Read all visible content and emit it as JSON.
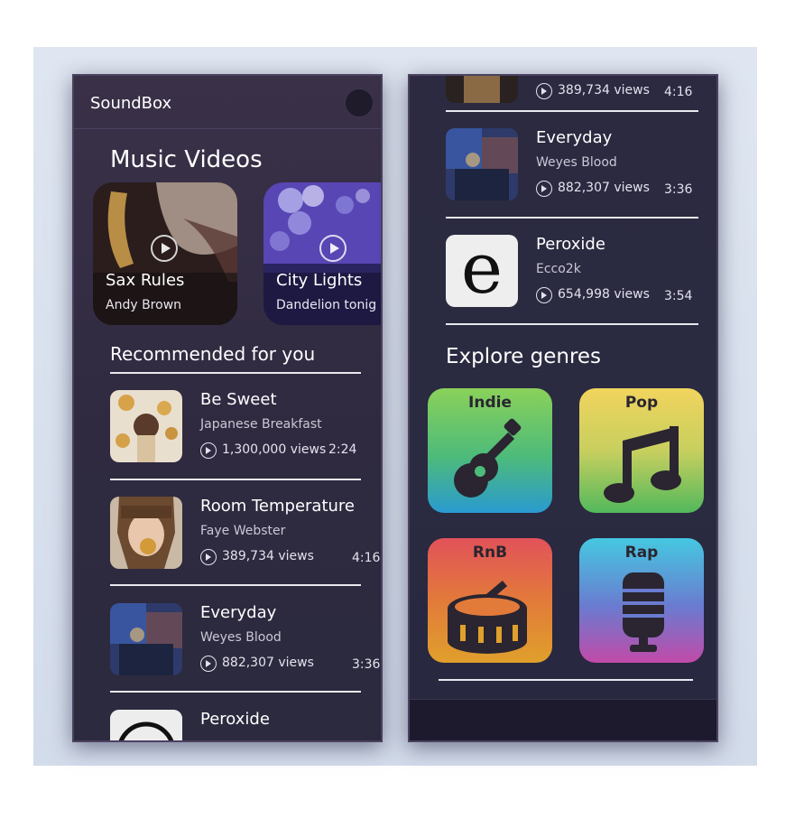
{
  "app": {
    "title": "SoundBox"
  },
  "left": {
    "section_title": "Music Videos",
    "featured": [
      {
        "title": "Sax Rules",
        "artist": "Andy Brown"
      },
      {
        "title": "City Lights",
        "artist": "Dandelion tonig"
      }
    ],
    "recommended_title": "Recommended for you",
    "list": [
      {
        "title": "Be Sweet",
        "artist": "Japanese Breakfast",
        "views": "1,300,000 views",
        "duration": "2:24"
      },
      {
        "title": "Room Temperature",
        "artist": "Faye Webster",
        "views": "389,734 views",
        "duration": "4:16"
      },
      {
        "title": "Everyday",
        "artist": "Weyes Blood",
        "views": "882,307 views",
        "duration": "3:36"
      },
      {
        "title": "Peroxide"
      }
    ]
  },
  "right": {
    "list": [
      {
        "views": "389,734 views",
        "duration": "4:16"
      },
      {
        "title": "Everyday",
        "artist": "Weyes Blood",
        "views": "882,307 views",
        "duration": "3:36"
      },
      {
        "title": "Peroxide",
        "artist": "Ecco2k",
        "views": "654,998 views",
        "duration": "3:54"
      }
    ],
    "genres_title": "Explore genres",
    "genres": [
      {
        "label": "Indie",
        "icon": "guitar-icon"
      },
      {
        "label": "Pop",
        "icon": "music-note-icon"
      },
      {
        "label": "RnB",
        "icon": "drum-icon"
      },
      {
        "label": "Rap",
        "icon": "microphone-icon"
      }
    ],
    "peroxide_thumb_letter": "e"
  }
}
